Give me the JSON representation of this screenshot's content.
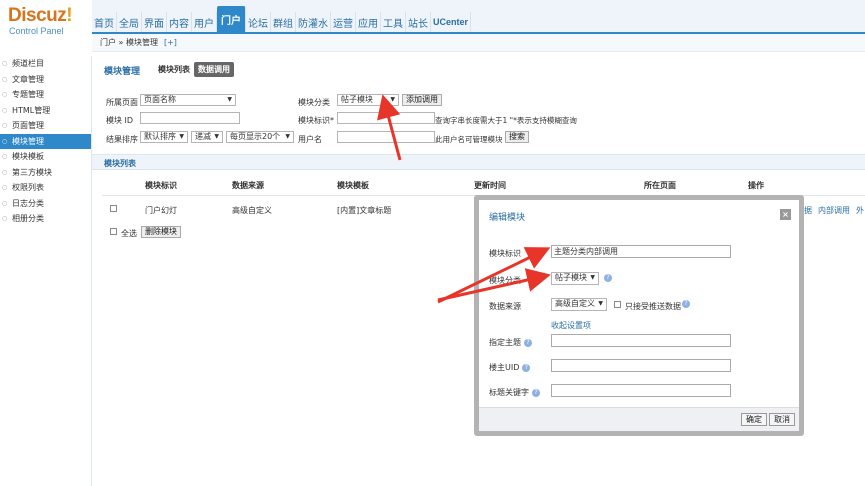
{
  "logo": {
    "main": "Discuz",
    "excl": "!",
    "sub": "Control Panel"
  },
  "topnav": [
    "首页",
    "全局",
    "界面",
    "内容",
    "用户",
    "门户",
    "论坛",
    "群组",
    "防灌水",
    "运营",
    "应用",
    "工具",
    "站长",
    "UCenter"
  ],
  "topnav_active": "门户",
  "breadcrumb": {
    "path": "门户 » 模块管理",
    "plus": "[+]"
  },
  "sidebar": [
    "频道栏目",
    "文章管理",
    "专题管理",
    "HTML管理",
    "页面管理",
    "模块管理",
    "模块模板",
    "第三方模块",
    "权限列表",
    "日志分类",
    "相册分类"
  ],
  "sidebar_active": "模块管理",
  "main": {
    "title": "模块管理",
    "tab1": "模块列表",
    "tab2": "数据调用",
    "filters": {
      "page_label": "所属页面",
      "page_value": "页面名称",
      "category_label": "模块分类",
      "category_value": "帖子模块",
      "add_btn": "添加调用",
      "id_label": "模块 ID",
      "mark_label": "模块标识*",
      "mark_hint": "查询字串长度需大于1 \"*表示支持模糊查询",
      "sort_label": "结果排序",
      "sort_value": "默认排序",
      "order_value": "递减",
      "perpage_value": "每页显示20个",
      "user_label": "用户名",
      "user_hint": "此用户名可管理模块",
      "search_btn": "搜索"
    },
    "list_title": "模块列表",
    "columns": [
      "模块标识",
      "数据来源",
      "模块模板",
      "更新时间",
      "所在页面",
      "操作"
    ],
    "rows": [
      {
        "mark": "门户幻灯",
        "source": "高级自定义",
        "template": "[内置]文章标题"
      }
    ],
    "row_actions": [
      "据",
      "内部调用",
      "外"
    ],
    "select_all": "全选",
    "delete_btn": "删除模块"
  },
  "modal": {
    "title": "编辑模块",
    "close": "×",
    "mark_label": "模块标识",
    "mark_value": "主题分类内部调用",
    "category_label": "模块分类",
    "category_value": "帖子模块",
    "source_label": "数据来源",
    "source_value": "高级自定义",
    "push_label": "只接receive推送数据",
    "collapse_link": "收起设置项",
    "topic_label": "指定主题",
    "uid_label": "楼主UID",
    "keyword_label": "标题关键字",
    "ok_btn": "确定",
    "cancel_btn": "取消",
    "help_glyph": "?"
  },
  "colors": {
    "accent": "#2e88c9",
    "arrow": "#e8352a"
  }
}
